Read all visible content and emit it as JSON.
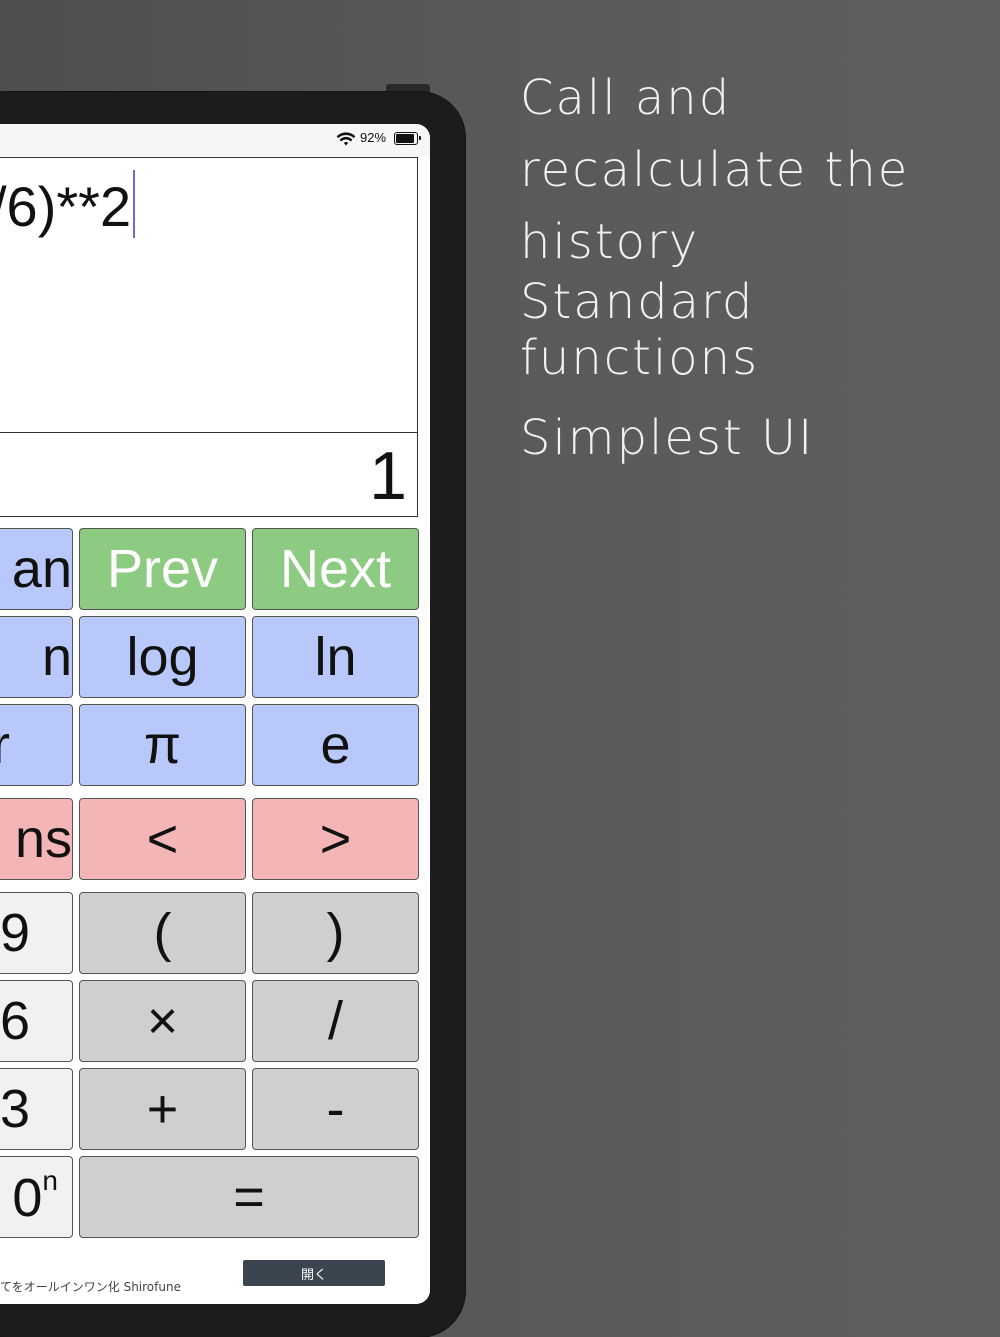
{
  "promo": {
    "line1": "Call and recalculate the history",
    "line2": "Standard functions",
    "line3": "Simplest UI"
  },
  "status": {
    "battery_percent_text": "92%",
    "battery_level": 0.92
  },
  "calculator": {
    "expression_visible": "/6)**2",
    "expression_cut_glyph": "*",
    "result": "1"
  },
  "keys": {
    "row1": [
      "an",
      "Prev",
      "Next"
    ],
    "row2": [
      "n",
      "log",
      "ln"
    ],
    "row3": [
      "r",
      "π",
      "e"
    ],
    "row4": [
      "ns",
      "<",
      ">"
    ],
    "row5": [
      "9",
      "(",
      ")"
    ],
    "row6": [
      "6",
      "×",
      "/"
    ],
    "row7": [
      "3",
      "+",
      "-"
    ],
    "row8_left_base": "0",
    "row8_left_sup": "n",
    "row8_equals": "="
  },
  "ad": {
    "text": "てをオールインワン化 Shirofune",
    "button": "開く"
  },
  "colors": {
    "green_key": "#8ecb82",
    "blue_key": "#b9c8fa",
    "red_key": "#f3b5b5",
    "grey_key": "#cfcfcf",
    "white_key": "#f1f1f1",
    "cursor": "#6a6adf",
    "background": "#5a5a5a"
  }
}
